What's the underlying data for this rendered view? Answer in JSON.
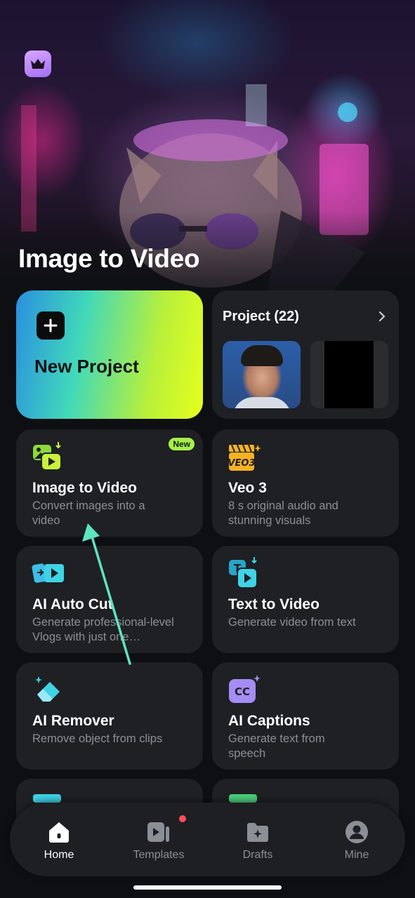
{
  "hero": {
    "title": "Image to Video",
    "crown_icon": "crown-icon"
  },
  "new_project": {
    "label": "New Project"
  },
  "project": {
    "title": "Project (22)"
  },
  "tools": [
    {
      "title": "Image to Video",
      "desc": "Convert images into a video",
      "badge": "New",
      "icon": "image-to-video-icon"
    },
    {
      "title": "Veo 3",
      "desc": "8 s original audio and stunning visuals",
      "icon": "veo3-icon"
    },
    {
      "title": "AI Auto Cut",
      "desc": "Generate professional-level Vlogs with just one…",
      "icon": "auto-cut-icon"
    },
    {
      "title": "Text to Video",
      "desc": "Generate video from text",
      "icon": "text-to-video-icon"
    },
    {
      "title": "AI Remover",
      "desc": "Remove object from clips",
      "icon": "eraser-icon"
    },
    {
      "title": "AI Captions",
      "desc": "Generate text from speech",
      "icon": "captions-icon"
    }
  ],
  "nav": [
    {
      "label": "Home",
      "icon": "home-icon",
      "active": true
    },
    {
      "label": "Templates",
      "icon": "templates-icon",
      "dot": true
    },
    {
      "label": "Drafts",
      "icon": "drafts-folder-icon"
    },
    {
      "label": "Mine",
      "icon": "profile-icon"
    }
  ],
  "colors": {
    "accent_green": "#a6f04a",
    "accent_cyan": "#3fd3e6",
    "annotation_arrow": "#5fe3c0"
  }
}
